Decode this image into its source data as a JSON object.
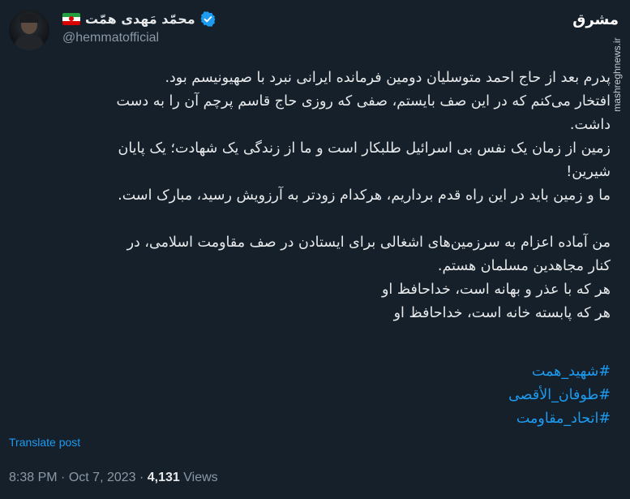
{
  "author": {
    "display_name": "محمّد مَهدی همّت",
    "handle": "@hemmatofficial"
  },
  "watermark": {
    "logo_text": "مشرق",
    "url": "mashreghnews.ir"
  },
  "tweet": {
    "lines": [
      "پدرم بعد از حاج احمد متوسلیان دومین فرمانده ایرانی نبرد با صهیونیسم بود.",
      "افتخار می‌کنم که در این صف بایستم، صفی که روزی حاج قاسم پرچم آن را به دست",
      "داشت.",
      "زمین از زمان یک نفس بی اسرائیل طلبکار است و ما از زندگی یک شهادت؛ یک پایان",
      "شیرین!",
      "ما و زمین باید در این راه قدم برداریم، هرکدام زودتر به آرزویش رسید، مبارک است."
    ],
    "lines2": [
      "من آماده اعزام به سرزمین‌های اشغالی برای ایستادن در صف مقاومت اسلامی، در",
      "کنار مجاهدین مسلمان هستم.",
      "هر که با عذر و بهانه است، خداحافظ او",
      "هر که پابسته خانه است، خداحافظ او"
    ],
    "hashtags": [
      "#شهید_همت",
      "#طوفان_الأقصی",
      "#اتحاد_مقاومت"
    ]
  },
  "translate_label": "Translate post",
  "meta": {
    "time": "8:38 PM",
    "date": "Oct 7, 2023",
    "separator": "·",
    "views_count": "4,131",
    "views_label": "Views"
  },
  "colors": {
    "background": "#15202b",
    "text": "#e7e9ea",
    "secondary": "#8b98a5",
    "link": "#1d9bf0"
  }
}
